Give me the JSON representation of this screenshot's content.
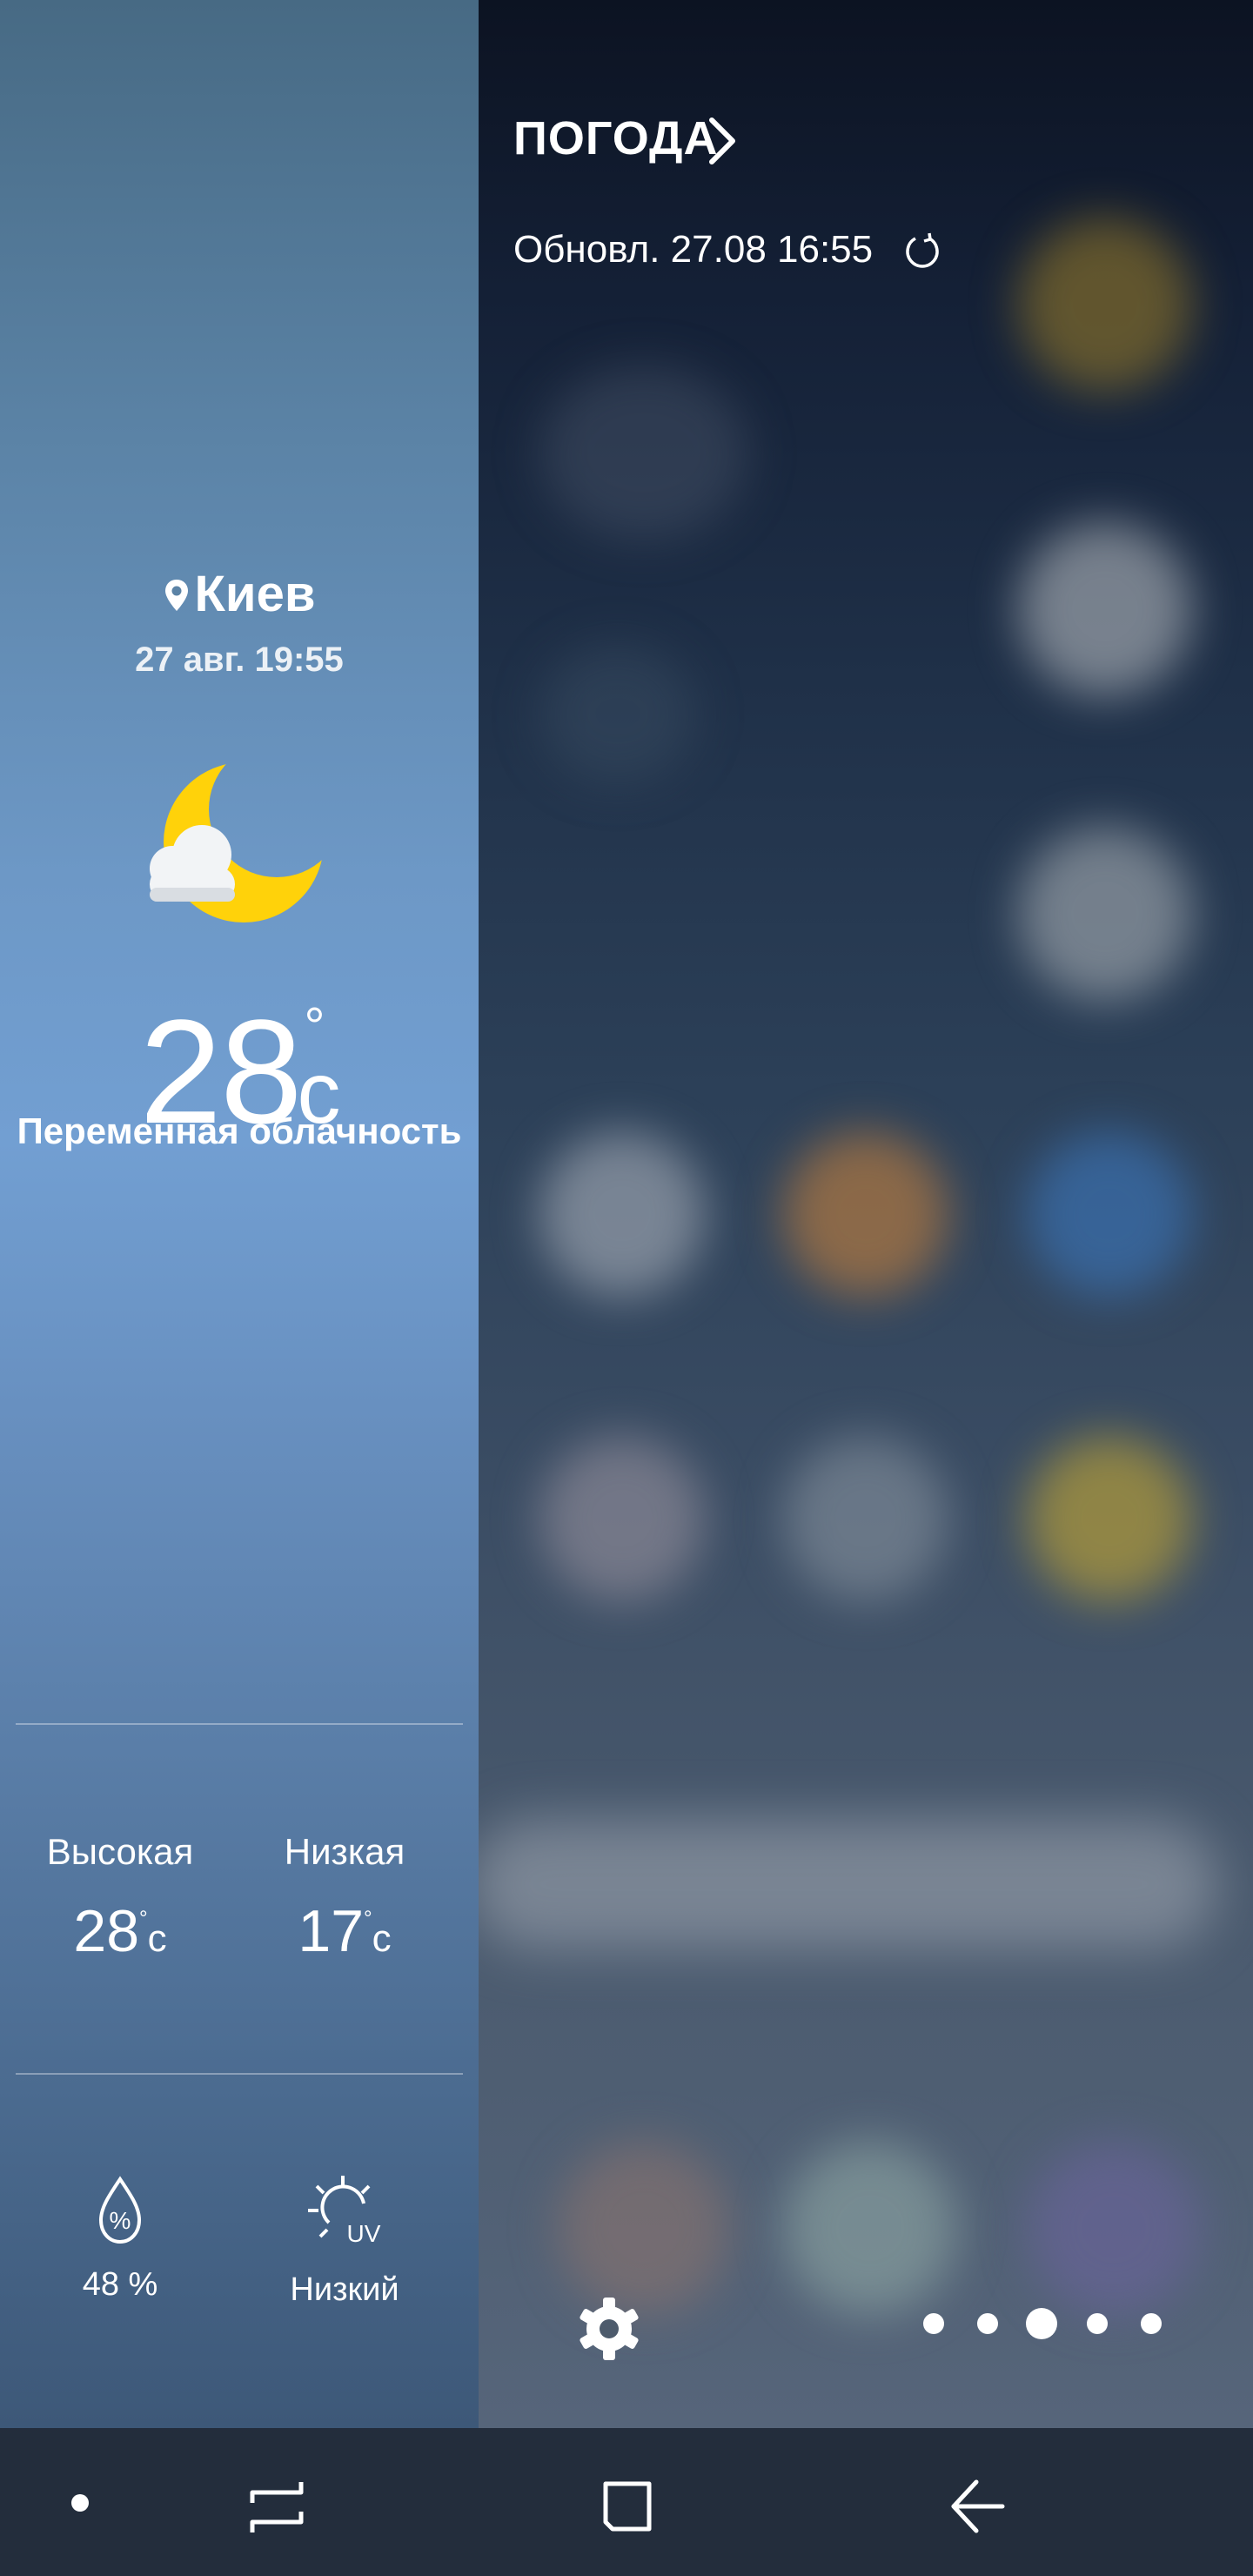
{
  "weather_panel": {
    "location": "Киев",
    "date_time": "27 авг. 19:55",
    "temperature": "28",
    "temperature_unit": "c",
    "condition": "Переменная облачность",
    "high_label": "Высокая",
    "high_value": "28",
    "low_label": "Низкая",
    "low_value": "17",
    "humidity_value": "48 %",
    "uv_label": "UV",
    "uv_value": "Низкий",
    "icon": "partly-cloudy-night-icon"
  },
  "edge_header": {
    "title": "ПОГОДА",
    "updated_text": "Обновл.  27.08  16:55"
  },
  "page_indicator": {
    "total": 5,
    "active_index": 2
  },
  "navbar": {
    "items": [
      "dot-button",
      "recent-apps-button",
      "home-button",
      "back-button"
    ]
  },
  "colors": {
    "sun_moon_yellow": "#FFD20A",
    "cloud_white": "#F2F4F6",
    "navbar_bg": "#232D3C"
  }
}
